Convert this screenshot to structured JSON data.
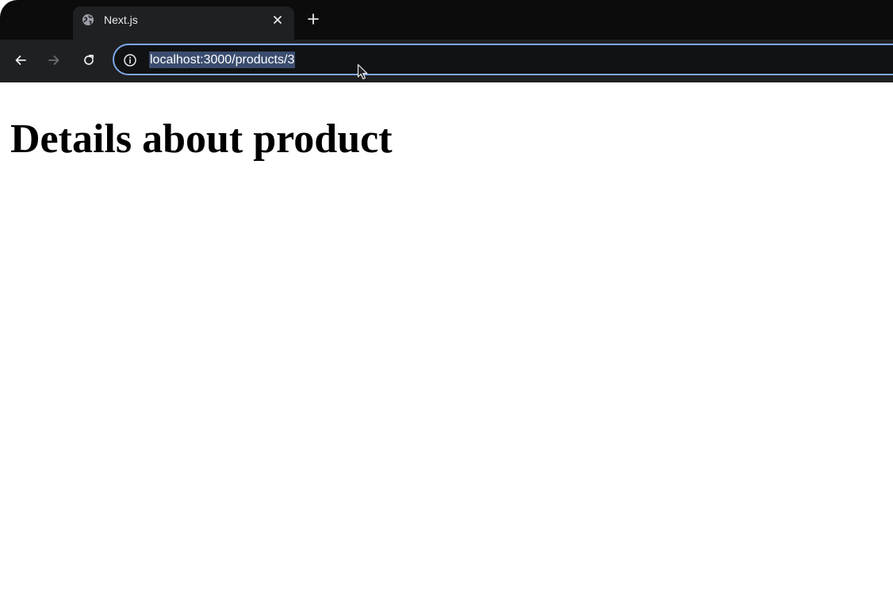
{
  "browser": {
    "tab": {
      "title": "Next.js",
      "favicon": "globe-icon"
    },
    "new_tab": "plus-icon",
    "nav": {
      "back": "arrow-left-icon",
      "forward": "arrow-right-icon",
      "reload": "reload-icon"
    },
    "address_bar": {
      "url": "localhost:3000/products/3",
      "site_info": "info-icon",
      "selected": true
    }
  },
  "page": {
    "heading": "Details about product"
  },
  "colors": {
    "tab_strip": "#0c0c0d",
    "toolbar": "#1f2021",
    "omnibox_focus_ring": "#7ca7e8",
    "url_selection": "#3b4d6f",
    "page_background": "#ffffff",
    "heading_text": "#000000"
  }
}
